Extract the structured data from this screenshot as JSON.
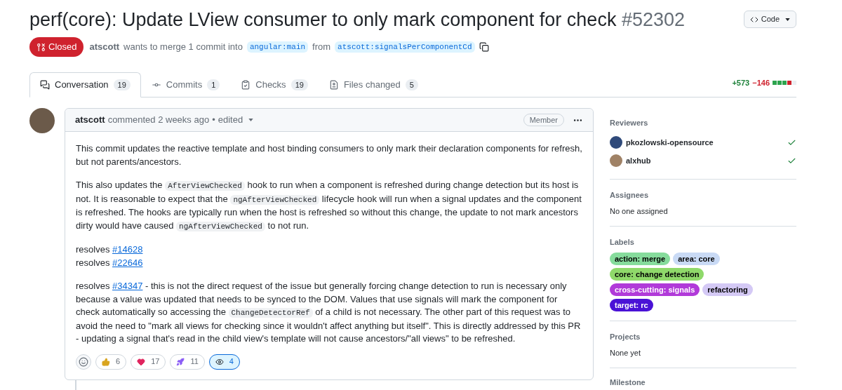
{
  "title": {
    "text": "perf(core): Update LView consumer to only mark component for check",
    "number": "#52302"
  },
  "code_button": "Code",
  "status": {
    "label": "Closed"
  },
  "summary": {
    "author": "atscott",
    "text_1": "wants to merge 1 commit into",
    "base": "angular:main",
    "text_2": "from",
    "head": "atscott:signalsPerComponentCd"
  },
  "tabs": [
    {
      "kind": "conversation",
      "label": "Conversation",
      "count": "19",
      "selected": true
    },
    {
      "kind": "commits",
      "label": "Commits",
      "count": "1",
      "selected": false
    },
    {
      "kind": "checks",
      "label": "Checks",
      "count": "19",
      "selected": false
    },
    {
      "kind": "files",
      "label": "Files changed",
      "count": "5",
      "selected": false
    }
  ],
  "diffstat": {
    "additions": "+573",
    "deletions": "−146",
    "blocks": [
      {
        "color": "#2da44e"
      },
      {
        "color": "#2da44e"
      },
      {
        "color": "#2da44e"
      },
      {
        "color": "#cf222e"
      },
      {
        "color": "#eaeef2"
      }
    ]
  },
  "comment": {
    "author": "atscott",
    "meta": "commented 2 weeks ago",
    "separator": "•",
    "edited": "edited",
    "badge": "Member",
    "blocks": [
      {
        "lines": [
          [
            {
              "kind": "text",
              "text": "This commit updates the reactive template and host binding consumers to only mark their declaration components for refresh, but not parents/ancestors."
            }
          ]
        ]
      },
      {
        "lines": [
          [
            {
              "kind": "text",
              "text": "This also updates the "
            },
            {
              "kind": "code",
              "text": "AfterViewChecked"
            },
            {
              "kind": "text",
              "text": " hook to run when a component is refreshed during change detection but its host is not. It is reasonable to expect that the "
            },
            {
              "kind": "code",
              "text": "ngAfterViewChecked"
            },
            {
              "kind": "text",
              "text": " lifecycle hook will run when a signal updates and the component is refreshed. The hooks are typically run when the host is refreshed so without this change, the update to not mark ancestors dirty would have caused "
            },
            {
              "kind": "code",
              "text": "ngAfterViewChecked"
            },
            {
              "kind": "text",
              "text": " to not run."
            }
          ]
        ]
      },
      {
        "lines": [
          [
            {
              "kind": "text",
              "text": "resolves "
            },
            {
              "kind": "link",
              "text": "#14628"
            }
          ],
          [
            {
              "kind": "text",
              "text": "resolves "
            },
            {
              "kind": "link",
              "text": "#22646"
            }
          ]
        ]
      },
      {
        "lines": [
          [
            {
              "kind": "text",
              "text": "resolves "
            },
            {
              "kind": "link",
              "text": "#34347"
            },
            {
              "kind": "text",
              "text": " - this is not the direct request of the issue but generally forcing change detection to run is necessary only because a value was updated that needs to be synced to the DOM. Values that use signals will mark the component for check automatically so accessing the "
            },
            {
              "kind": "code",
              "text": "ChangeDetectorRef"
            },
            {
              "kind": "text",
              "text": " of a child is not necessary. The other part of this request was to avoid the need to \"mark all views for checking since it wouldn't affect anything but itself\". This is directly addressed by this PR - updating a signal that's read in the child view's template will not cause ancestors/\"all views\" to be refreshed."
            }
          ]
        ]
      }
    ],
    "reactions": [
      {
        "kind": "thumbs-up",
        "count": "6",
        "selected": false
      },
      {
        "kind": "heart",
        "count": "17",
        "selected": false
      },
      {
        "kind": "rocket",
        "count": "11",
        "selected": false
      },
      {
        "kind": "eyes",
        "count": "4",
        "selected": true
      }
    ]
  },
  "sidebar": {
    "reviewers": {
      "heading": "Reviewers",
      "items": [
        {
          "name": "pkozlowski-opensource",
          "approved": true,
          "color": "#2f4a7a"
        },
        {
          "name": "alxhub",
          "approved": true,
          "color": "#a08266"
        }
      ]
    },
    "assignees": {
      "heading": "Assignees",
      "empty": "No one assigned"
    },
    "labels": {
      "heading": "Labels",
      "items": [
        {
          "text": "action: merge",
          "color": "#86dc9c"
        },
        {
          "text": "area: core",
          "color": "#c9daf5"
        },
        {
          "text": "core: change detection",
          "color": "#8fd96a"
        },
        {
          "text": "cross-cutting: signals",
          "color": "#b13ad9"
        },
        {
          "text": "refactoring",
          "color": "#d4c9f5"
        },
        {
          "text": "target: rc",
          "color": "#4a12d6"
        }
      ]
    },
    "projects": {
      "heading": "Projects",
      "empty": "None yet"
    },
    "milestone": {
      "heading": "Milestone"
    }
  }
}
